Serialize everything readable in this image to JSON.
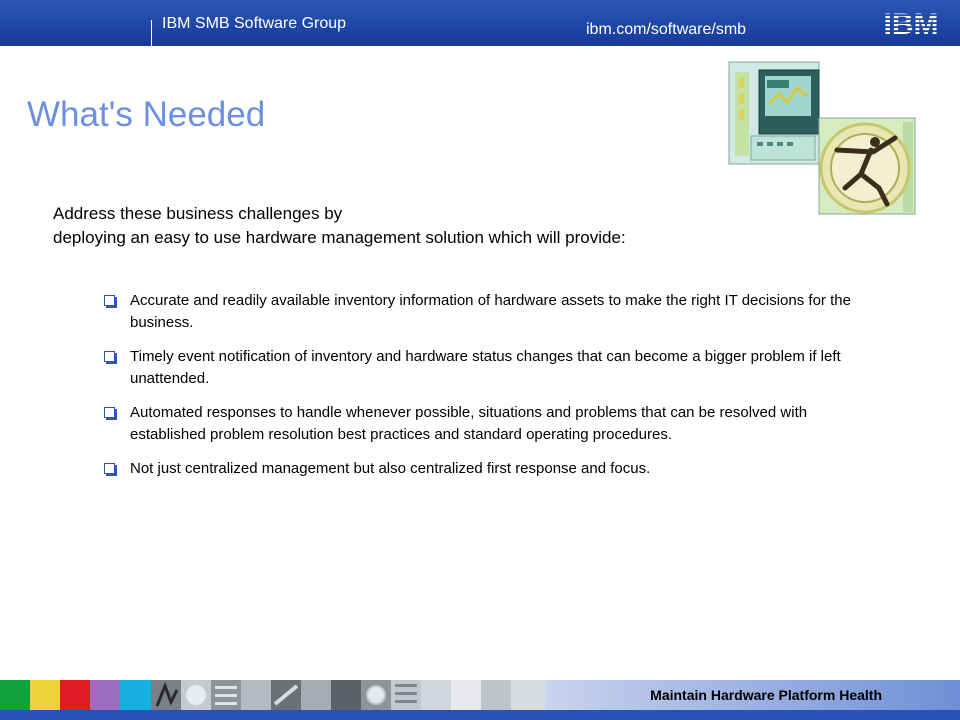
{
  "header": {
    "group_name": "IBM SMB Software Group",
    "site_url": "ibm.com/software/smb",
    "logo_text": "IBM"
  },
  "slide": {
    "title": "What's Needed",
    "intro": [
      "Address these business challenges by",
      "deploying an easy to use hardware management solution which will provide:"
    ],
    "bullets": [
      "Accurate and readily available inventory information of hardware assets to make the right IT decisions for the business.",
      "Timely event notification of inventory and hardware status changes that can become a bigger problem if left unattended.",
      "Automated responses to handle whenever possible, situations and problems that can be resolved with established problem resolution best practices and standard operating procedures.",
      "Not just centralized management but also centralized first response and focus."
    ]
  },
  "footer": {
    "title": "Maintain Hardware Platform Health",
    "swatches": [
      "#13a03b",
      "#f0d23a",
      "#e01c24",
      "#9b6dbf",
      "#17aee0"
    ]
  },
  "colors": {
    "header_blue": "#1f47a6",
    "title_blue": "#6b8fe3",
    "bullet_blue": "#2d55b6"
  },
  "icons": {
    "bullet": "checkbox-square-icon",
    "clipart": "business-computer-clipart"
  }
}
